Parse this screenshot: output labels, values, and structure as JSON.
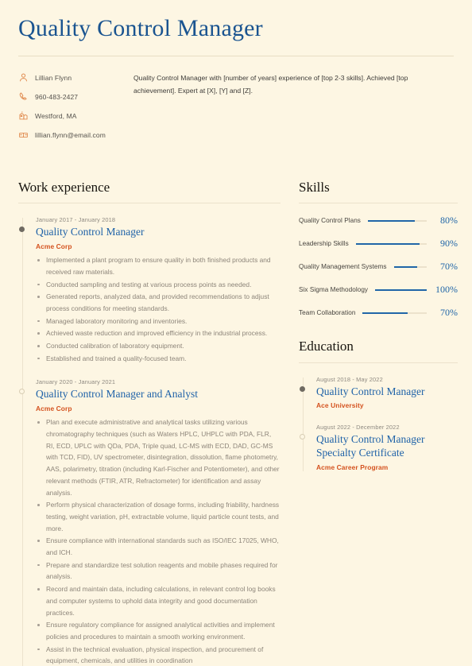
{
  "document": {
    "title": "Quality Control Manager",
    "summary": "Quality Control Manager with [number of years] experience of [top 2-3 skills]. Achieved [top achievement]. Expert at [X], [Y] and [Z]."
  },
  "colors": {
    "background": "#fdf6e3",
    "title_blue": "#1a5490",
    "link_blue": "#1f62a8",
    "accent_orange": "#d4521f",
    "body_gray": "#8d857a",
    "rule": "#ece2cc"
  },
  "contact": [
    {
      "icon": "person-icon",
      "value": "Lillian Flynn"
    },
    {
      "icon": "phone-icon",
      "value": "960-483-2427"
    },
    {
      "icon": "location-icon",
      "value": "Westford, MA"
    },
    {
      "icon": "mailbox-icon",
      "value": "lillian.flynn@email.com"
    }
  ],
  "work_experience": {
    "heading": "Work experience",
    "entries": [
      {
        "date": "January 2017 - January 2018",
        "title": "Quality Control Manager",
        "organization": "Acme Corp",
        "marker": "filled",
        "bullets": [
          "Implemented a plant program to ensure quality in both finished products and received raw materials.",
          "Conducted sampling and testing at various process points as needed.",
          "Generated reports, analyzed data, and provided recommendations to adjust process conditions for meeting standards.",
          "Managed laboratory monitoring and inventories.",
          "Achieved waste reduction and improved efficiency in the industrial process.",
          "Conducted calibration of laboratory equipment.",
          "Established and trained a quality-focused team."
        ]
      },
      {
        "date": "January 2020 - January 2021",
        "title": "Quality Control Manager and Analyst",
        "organization": "Acme Corp",
        "marker": "hollow",
        "bullets": [
          "Plan and execute administrative and analytical tasks utilizing various chromatography techniques (such as Waters HPLC, UHPLC with PDA, FLR, RI, ECD, UPLC with QDa, PDA, Triple quad, LC-MS with ECD, DAD, GC-MS with TCD, FID), UV spectrometer, disintegration, dissolution, flame photometry, AAS, polarimetry, titration (including Karl-Fischer and Potentiometer), and other relevant methods (FTIR, ATR, Refractometer) for identification and assay analysis.",
          "Perform physical characterization of dosage forms, including friability, hardness testing, weight variation, pH, extractable volume, liquid particle count tests, and more.",
          "Ensure compliance with international standards such as ISO/IEC 17025, WHO, and ICH.",
          "Prepare and standardize test solution reagents and mobile phases required for analysis.",
          "Record and maintain data, including calculations, in relevant control log books and computer systems to uphold data integrity and good documentation practices.",
          "Ensure regulatory compliance for assigned analytical activities and implement policies and procedures to maintain a smooth working environment.",
          "Assist in the technical evaluation, physical inspection, and procurement of equipment, chemicals, and utilities in coordination"
        ]
      }
    ]
  },
  "skills": {
    "heading": "Skills",
    "items": [
      {
        "name": "Quality Control Plans",
        "percent_label": "80%",
        "percent": 80
      },
      {
        "name": "Leadership Skills",
        "percent_label": "90%",
        "percent": 90
      },
      {
        "name": "Quality Management Systems",
        "percent_label": "70%",
        "percent": 70
      },
      {
        "name": "Six Sigma Methodology",
        "percent_label": "100%",
        "percent": 100
      },
      {
        "name": "Team Collaboration",
        "percent_label": "70%",
        "percent": 70
      }
    ]
  },
  "education": {
    "heading": "Education",
    "entries": [
      {
        "date": "August 2018 - May 2022",
        "title": "Quality Control Manager",
        "organization": "Ace University",
        "marker": "filled"
      },
      {
        "date": "August 2022 - December 2022",
        "title": "Quality Control Manager Specialty Certificate",
        "organization": "Acme Career Program",
        "marker": "hollow"
      }
    ]
  }
}
